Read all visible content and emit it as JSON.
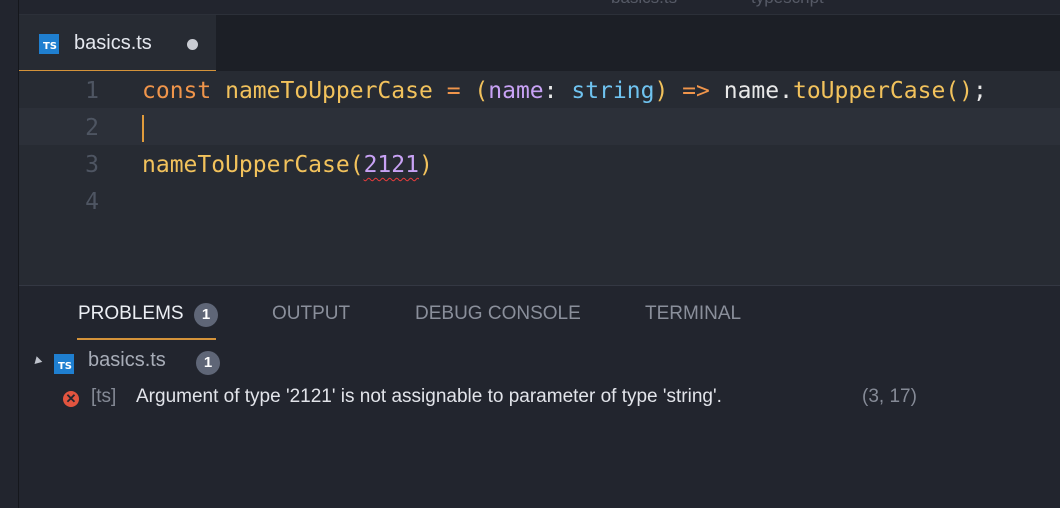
{
  "window": {
    "title_fragments": [
      "basics.ts",
      "typescript"
    ]
  },
  "editor_tabs": [
    {
      "label": "basics.ts",
      "icon": "typescript-file-icon",
      "icon_text": "TS",
      "modified": true,
      "active": true
    }
  ],
  "editor": {
    "line_numbers": [
      "1",
      "2",
      "3",
      "4"
    ],
    "lines": [
      [
        {
          "text": "const",
          "kind": "kw"
        },
        {
          "text": " ",
          "kind": "plain"
        },
        {
          "text": "nameToUpperCase",
          "kind": "fn"
        },
        {
          "text": " ",
          "kind": "plain"
        },
        {
          "text": "=",
          "kind": "kw"
        },
        {
          "text": " ",
          "kind": "plain"
        },
        {
          "text": "(",
          "kind": "paren"
        },
        {
          "text": "name",
          "kind": "param"
        },
        {
          "text": ": ",
          "kind": "plain"
        },
        {
          "text": "string",
          "kind": "type"
        },
        {
          "text": ")",
          "kind": "paren"
        },
        {
          "text": " ",
          "kind": "plain"
        },
        {
          "text": "=>",
          "kind": "kw"
        },
        {
          "text": " ",
          "kind": "plain"
        },
        {
          "text": "name",
          "kind": "plain"
        },
        {
          "text": ".",
          "kind": "plain"
        },
        {
          "text": "toUpperCase",
          "kind": "fn"
        },
        {
          "text": "()",
          "kind": "paren"
        },
        {
          "text": ";",
          "kind": "plain"
        }
      ],
      [],
      [
        {
          "text": "nameToUpperCase",
          "kind": "fn"
        },
        {
          "text": "(",
          "kind": "paren"
        },
        {
          "text": "2121",
          "kind": "num"
        },
        {
          "text": ")",
          "kind": "paren"
        }
      ],
      []
    ],
    "cursor_line": 2
  },
  "panel": {
    "tabs": [
      {
        "label": "PROBLEMS",
        "badge": "1",
        "active": true
      },
      {
        "label": "OUTPUT"
      },
      {
        "label": "DEBUG CONSOLE"
      },
      {
        "label": "TERMINAL"
      }
    ],
    "problems": {
      "file": {
        "label": "basics.ts",
        "icon_text": "TS",
        "count": "1"
      },
      "items": [
        {
          "severity": "error",
          "icon": "error-icon",
          "icon_glyph": "✕",
          "source": "[ts]",
          "message": "Argument of type '2121' is not assignable to parameter of type 'string'.",
          "position": "(3, 17)"
        }
      ]
    }
  },
  "colors": {
    "accent": "#d4933a",
    "keyword": "#f0954b",
    "function": "#f2c25c",
    "parameter": "#c8a2f5",
    "type": "#6fc3f0",
    "error": "#e2543f"
  }
}
